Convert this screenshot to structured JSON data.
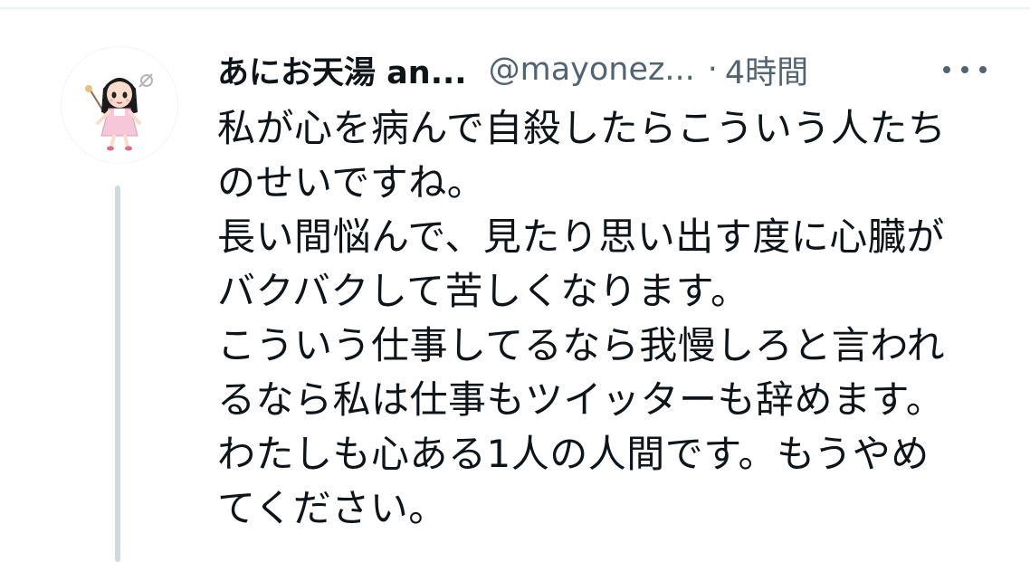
{
  "tweet": {
    "display_name": "あにお天湯 an...",
    "handle": "@mayonez...",
    "separator": "·",
    "time": "4時間",
    "more_icon": "more-horizontal-icon",
    "avatar_icon": "avatar-illustration",
    "lines": [
      "私が心を病んで自殺したらこういう人たち",
      "のせいですね。",
      "長い間悩んで、見たり思い出す度に心臓が",
      "バクバクして苦しくなります。",
      "こういう仕事してるなら我慢しろと言われ",
      "るなら私は仕事もツイッターも辞めます。",
      "わたしも心ある1人の人間です。もうやめ",
      "てください。"
    ]
  },
  "colors": {
    "text": "#0f1419",
    "secondary": "#536471",
    "thread_line": "#cfd9de"
  }
}
